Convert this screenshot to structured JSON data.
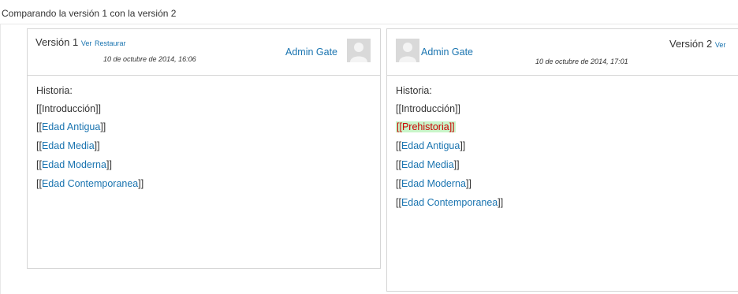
{
  "page_title": "Comparando la versión 1 con la versión 2",
  "left": {
    "version_label": "Versión 1",
    "ver_link": "Ver",
    "restaurar_link": "Restaurar",
    "date": "10 de octubre de 2014, 16:06",
    "author": "Admin Gate",
    "heading": "Historia:",
    "lines": [
      {
        "open": "[[",
        "text": "Introducción",
        "close": "]]",
        "type": "plain"
      },
      {
        "open": "[[",
        "text": "Edad Antigua",
        "close": "]]",
        "type": "link"
      },
      {
        "open": "[[",
        "text": "Edad Media",
        "close": "]]",
        "type": "link"
      },
      {
        "open": "[[",
        "text": "Edad Moderna",
        "close": "]]",
        "type": "link"
      },
      {
        "open": "[[",
        "text": "Edad Contemporanea",
        "close": "]]",
        "type": "link"
      }
    ]
  },
  "right": {
    "version_label": "Versión 2",
    "ver_link": "Ver",
    "date": "10 de octubre de 2014, 17:01",
    "author": "Admin Gate",
    "heading": "Historia:",
    "inserted_line": "[[Prehistoria]]",
    "lines": [
      {
        "open": "[[",
        "text": "Introducción",
        "close": "]]",
        "type": "plain"
      },
      {
        "open": "[[",
        "text": "Edad Antigua",
        "close": "]]",
        "type": "link"
      },
      {
        "open": "[[",
        "text": "Edad Media",
        "close": "]]",
        "type": "link"
      },
      {
        "open": "[[",
        "text": "Edad Moderna",
        "close": "]]",
        "type": "link"
      },
      {
        "open": "[[",
        "text": "Edad Contemporanea",
        "close": "]]",
        "type": "link"
      }
    ]
  },
  "colors": {
    "link": "#1a74b0",
    "inserted_bg": "#c9f5c9",
    "inserted_text": "#cc0000"
  },
  "icons": {
    "avatar": "user-avatar-icon"
  }
}
